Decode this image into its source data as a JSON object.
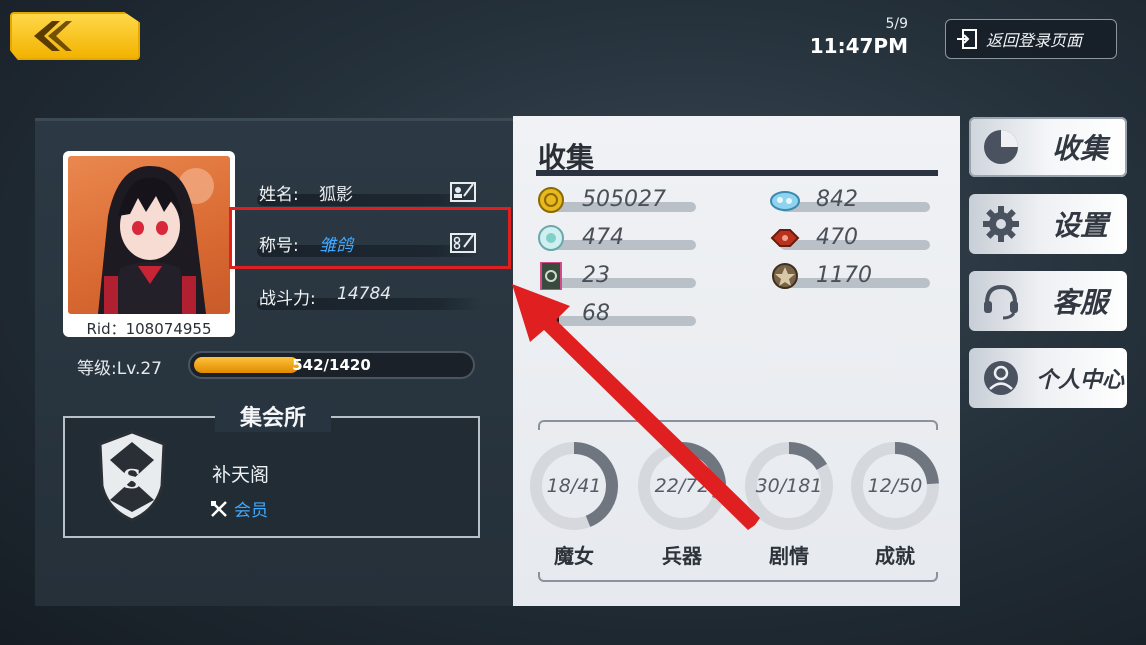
{
  "topbar": {
    "date": "5/9",
    "time": "11:47PM",
    "return_login_label": "返回登录页面"
  },
  "profile": {
    "rid_text": "Rid：108074955",
    "name_label": "姓名:",
    "name_value": "狐影",
    "title_label": "称号:",
    "title_value": "雏鸽",
    "power_label": "战斗力:",
    "power_value": "14784",
    "level_label": "等级:Lv.27",
    "xp_text": "542/1420",
    "xp_current": 542,
    "xp_max": 1420
  },
  "guild": {
    "section_title": "集会所",
    "name": "补天阁",
    "role": "会员"
  },
  "collection": {
    "title": "收集",
    "resources": [
      {
        "icon": "gold-coin-icon",
        "value": "505027"
      },
      {
        "icon": "blue-gem-icon",
        "value": "842"
      },
      {
        "icon": "crystal-orb-icon",
        "value": "474"
      },
      {
        "icon": "red-gem-icon",
        "value": "470"
      },
      {
        "icon": "card-ticket-icon",
        "value": "23"
      },
      {
        "icon": "bronze-medal-icon",
        "value": "1170"
      },
      {
        "icon": "device-item-icon",
        "value": "68"
      }
    ],
    "stats": [
      {
        "label": "魔女",
        "text": "18/41",
        "current": 18,
        "total": 41
      },
      {
        "label": "兵器",
        "text": "22/72",
        "current": 22,
        "total": 72
      },
      {
        "label": "剧情",
        "text": "30/181",
        "current": 30,
        "total": 181
      },
      {
        "label": "成就",
        "text": "12/50",
        "current": 12,
        "total": 50
      }
    ]
  },
  "side_menu": {
    "collect": "收集",
    "settings": "设置",
    "support": "客服",
    "personal": "个人中心"
  },
  "colors": {
    "accent_yellow": "#f2b300",
    "highlight_red": "#e02020",
    "link_blue": "#3fa8ff",
    "ring_fill": "#6f7680",
    "ring_track": "#d5d9de"
  }
}
